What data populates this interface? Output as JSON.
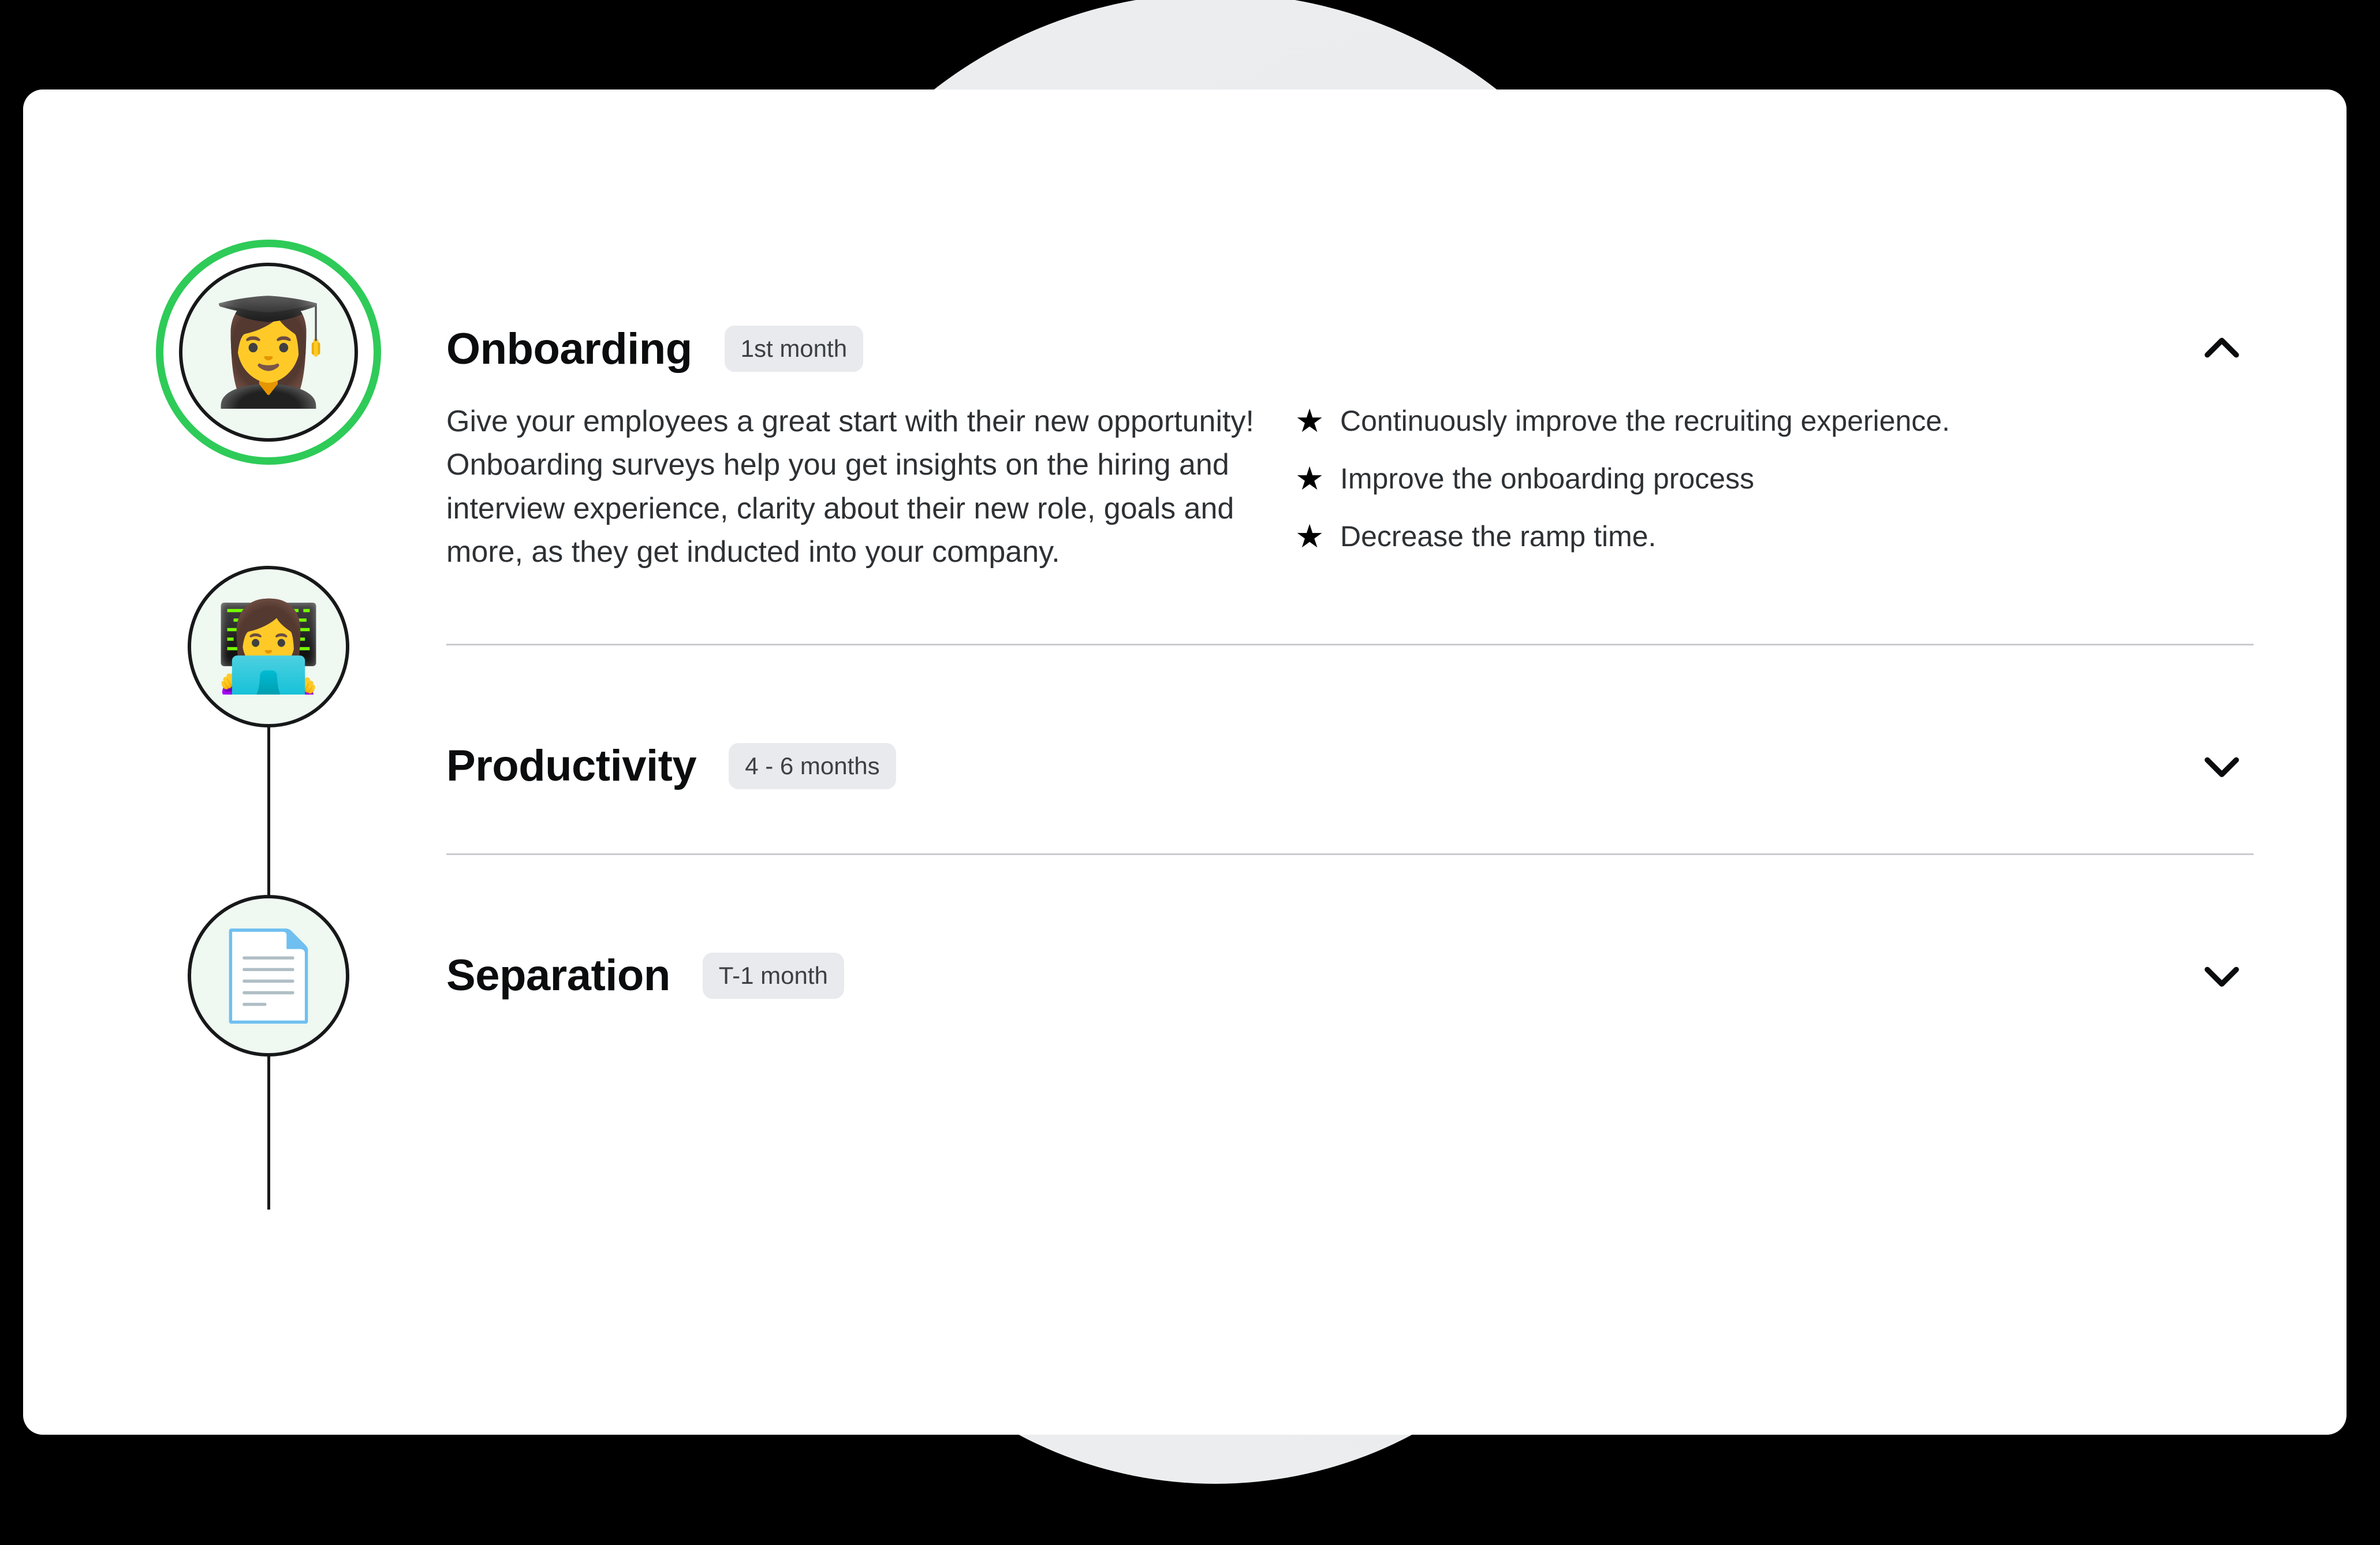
{
  "background": {
    "page_color": "#000000",
    "circle_color": "#eceef0"
  },
  "card": {
    "background": "#ffffff"
  },
  "timeline": {
    "active_ring_color": "#2ecb58",
    "node_ring_color": "#17181a",
    "node_fill_color": "#eff8f1",
    "nodes": [
      {
        "icon": "graduate-emoji",
        "glyph": "👩‍🎓",
        "state": "active"
      },
      {
        "icon": "technologist-emoji",
        "glyph": "👩‍💻",
        "state": "inactive"
      },
      {
        "icon": "page-document-emoji",
        "glyph": "📄",
        "state": "inactive"
      }
    ]
  },
  "accordion": {
    "badge_bg": "#e8eaed",
    "badge_text_color": "#3c4043",
    "sections": [
      {
        "title": "Onboarding",
        "badge": "1st month",
        "expanded": true,
        "chevron": "chevron-up-icon",
        "description": "Give your employees a great start with their new opportunity! Onboarding surveys help you get insights on the hiring and interview experience, clarity about their new role, goals and more, as they get inducted into your company.",
        "goals": [
          {
            "bullet": "★",
            "text": "Continuously improve the recruiting experience."
          },
          {
            "bullet": "★",
            "text": "Improve the onboarding process"
          },
          {
            "bullet": "★",
            "text": "Decrease the ramp time."
          }
        ]
      },
      {
        "title": "Productivity",
        "badge": "4 - 6 months",
        "expanded": false,
        "chevron": "chevron-down-icon"
      },
      {
        "title": "Separation",
        "badge": "T-1 month",
        "expanded": false,
        "chevron": "chevron-down-icon"
      }
    ]
  }
}
